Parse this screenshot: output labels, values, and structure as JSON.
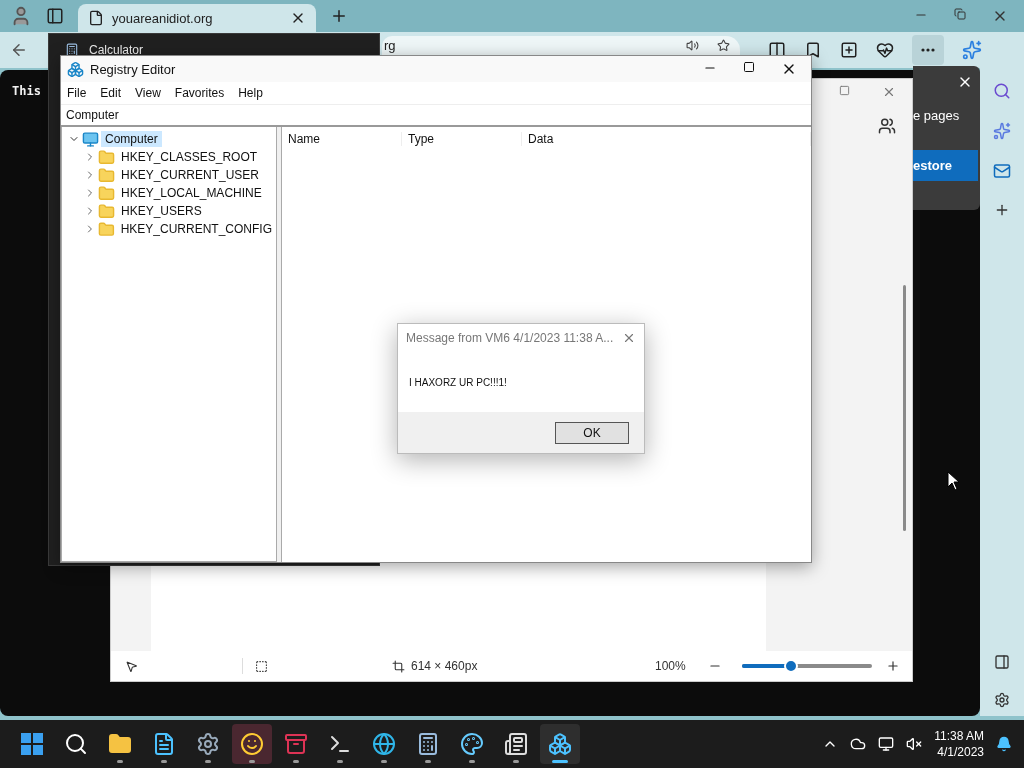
{
  "browser": {
    "tab": {
      "title": "youareanidiot.org"
    },
    "address": "rg",
    "page_text": "This"
  },
  "notification": {
    "text": "e pages",
    "button": "estore"
  },
  "viewer": {
    "dimensions": "614 × 460px",
    "zoom": {
      "reading": "100%",
      "level": 0.38
    }
  },
  "calculator": {
    "title": "Calculator"
  },
  "registry": {
    "title": "Registry Editor",
    "menu": [
      "File",
      "Edit",
      "View",
      "Favorites",
      "Help"
    ],
    "address": "Computer",
    "tree": [
      {
        "label": "Computer",
        "expanded": true,
        "selected": true,
        "children": [
          {
            "label": "HKEY_CLASSES_ROOT",
            "expanded": false,
            "selected": false
          },
          {
            "label": "HKEY_CURRENT_USER",
            "expanded": false,
            "selected": false
          },
          {
            "label": "HKEY_LOCAL_MACHINE",
            "expanded": false,
            "selected": false
          },
          {
            "label": "HKEY_USERS",
            "expanded": false,
            "selected": false
          },
          {
            "label": "HKEY_CURRENT_CONFIG",
            "expanded": false,
            "selected": false
          }
        ]
      }
    ],
    "columns": [
      "Name",
      "Type",
      "Data"
    ]
  },
  "message_box": {
    "title": "Message from VM6 4/1/2023 11:38 A...",
    "text": "I HAXORZ UR PC!!!1!",
    "button": "OK"
  },
  "taskbar": {
    "apps": [
      {
        "kind": "start",
        "selected": false,
        "flashing": false
      },
      {
        "kind": "search",
        "selected": false,
        "flashing": false
      },
      {
        "kind": "explorer",
        "selected": false,
        "flashing": false
      },
      {
        "kind": "notepad",
        "selected": false,
        "flashing": false
      },
      {
        "kind": "settings",
        "selected": false,
        "flashing": false
      },
      {
        "kind": "messenger",
        "selected": false,
        "flashing": true
      },
      {
        "kind": "archive",
        "selected": false,
        "flashing": false
      },
      {
        "kind": "terminal",
        "selected": false,
        "flashing": false
      },
      {
        "kind": "browser",
        "selected": false,
        "flashing": false
      },
      {
        "kind": "calculator",
        "selected": false,
        "flashing": false
      },
      {
        "kind": "paint",
        "selected": false,
        "flashing": false
      },
      {
        "kind": "viewer",
        "selected": false,
        "flashing": false
      },
      {
        "kind": "registry",
        "selected": true,
        "flashing": false
      }
    ],
    "time": "11:38 AM",
    "date": "4/1/2023"
  }
}
